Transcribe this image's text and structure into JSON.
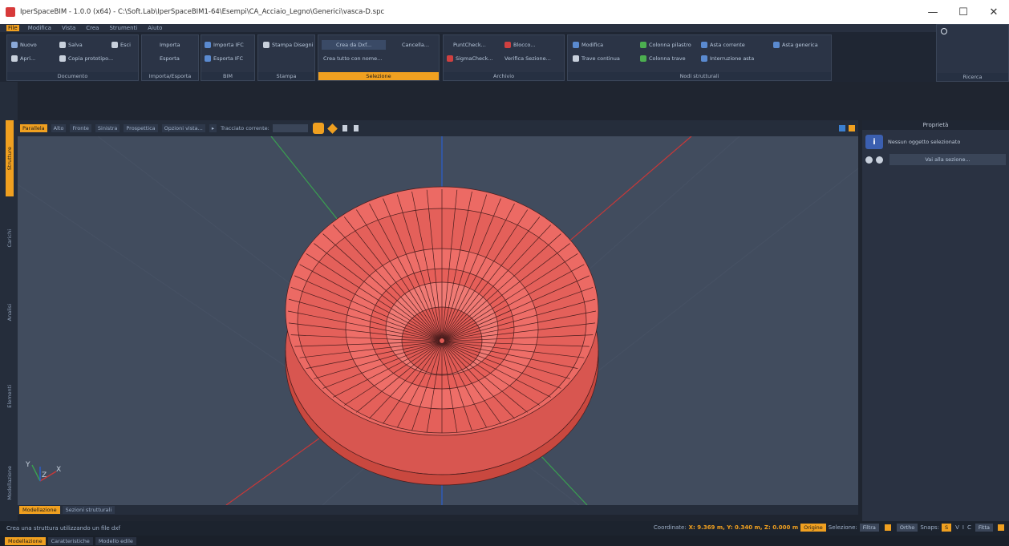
{
  "window": {
    "title": "IperSpaceBIM - 1.0.0 (x64) - C:\\Soft.Lab\\IperSpaceBIM1-64\\Esempi\\CA_Acciaio_Legno\\Generici\\vasca-D.spc",
    "controls": [
      "—",
      "☐",
      "✕"
    ]
  },
  "menu": [
    "File",
    "Modifica",
    "Vista",
    "Crea",
    "Strumenti",
    "Aiuto"
  ],
  "ribbon": {
    "documento": {
      "label": "Documento",
      "buttons": [
        "Nuovo",
        "Salva",
        "Esci",
        "Apri...",
        "Copia prototipo..."
      ]
    },
    "importa_esporta": {
      "label": "Importa/Esporta",
      "buttons": [
        "Importa",
        "Esporta"
      ]
    },
    "bim": {
      "label": "BIM",
      "buttons": [
        "Importa IFC",
        "Esporta IFC"
      ]
    },
    "stampa": {
      "label": "Stampa",
      "buttons": [
        "Stampa Disegni"
      ]
    },
    "selezione": {
      "label": "Selezione",
      "buttons": [
        "Crea da Dxf...",
        "Cancella...",
        "Crea tutto con nome..."
      ]
    },
    "archivio": {
      "label": "Archivio",
      "buttons": [
        "PuntCheck...",
        "Blocco...",
        "SigmaCheck...",
        "Verifica Sezione..."
      ]
    },
    "nodi": {
      "label": "Nodi strutturali",
      "buttons": [
        "Modifica",
        "Colonna pilastro",
        "Asta corrente",
        "Asta generica",
        "Trave continua",
        "Colonna trave",
        "Interruzione asta"
      ]
    },
    "right_box_label": "Ricerca"
  },
  "sidebar_tabs": [
    "Strutture",
    "Carichi",
    "Analisi",
    "Elementi",
    "Modellazione"
  ],
  "viewport_toolbar": {
    "views": [
      "Parallela",
      "Alto",
      "Fronte",
      "Sinistra",
      "Prospettica"
    ],
    "options": "Opzioni vista...",
    "trace_label": "Tracciato corrente:"
  },
  "viewport_tabs": [
    "Modellazione",
    "Sezioni strutturali"
  ],
  "axis_labels": {
    "y": "Y",
    "z": "Z",
    "x": "X"
  },
  "right_panel": {
    "title": "Proprietà",
    "info_text": "Nessun oggetto selezionato",
    "select_text": "Vai alla sezione..."
  },
  "status": {
    "message": "Crea una struttura utilizzando un file dxf",
    "coord_label": "Coordinate:",
    "coords": "X: 9.369 m, Y: 0.340 m, Z: 0.000 m",
    "origin_btn": "Origine",
    "selection_label": "Selezione:",
    "filter_btn": "Filtra",
    "other_btn": "Ortho",
    "snaps_label": "Snaps:",
    "snaps": [
      "S",
      "V",
      "I",
      "C"
    ],
    "fit_btn": "Fitta"
  },
  "bottom_tabs": [
    "Modellazione",
    "Caratteristiche",
    "Modello edile"
  ],
  "colors": {
    "accent": "#f0a020",
    "viewport_bg": "#414c5e",
    "model": "#e8635f",
    "model_edge": "#3a2020"
  }
}
